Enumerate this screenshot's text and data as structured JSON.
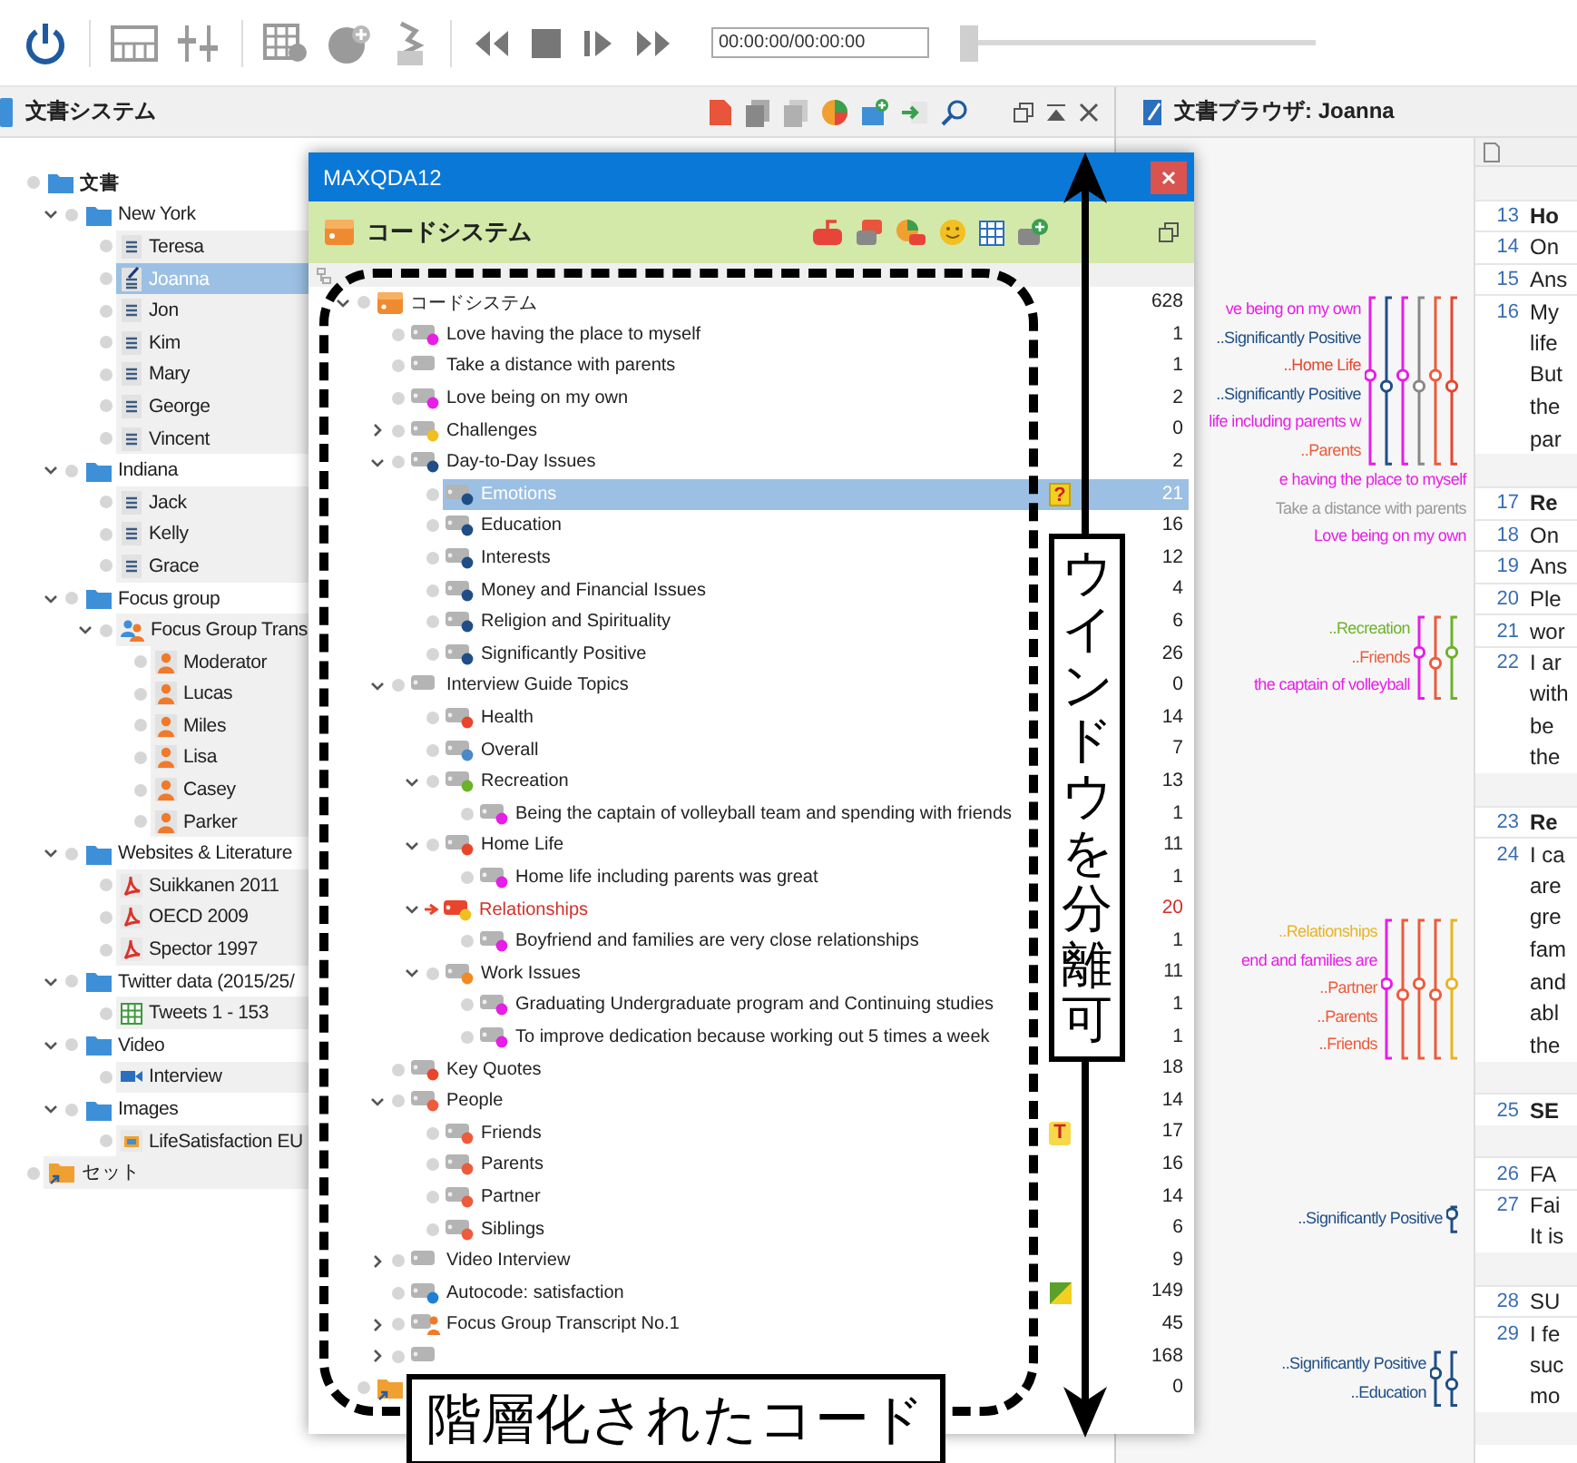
{
  "toolbar": {
    "time_field": "00:00:00/00:00:00",
    "position_slider": {
      "level": 0
    }
  },
  "document_system": {
    "title": "文書システム",
    "tree": [
      {
        "name": "文書",
        "kind": "root",
        "selected": false,
        "children": [
          {
            "name": "New York",
            "kind": "folder",
            "expanded": true,
            "selected": false,
            "children": [
              {
                "name": "Teresa",
                "kind": "text",
                "selected": false
              },
              {
                "name": "Joanna",
                "kind": "text-open",
                "selected": true
              },
              {
                "name": "Jon",
                "kind": "text",
                "selected": false
              },
              {
                "name": "Kim",
                "kind": "text",
                "selected": false
              },
              {
                "name": "Mary",
                "kind": "text",
                "selected": false
              },
              {
                "name": "George",
                "kind": "text",
                "selected": false
              },
              {
                "name": "Vincent",
                "kind": "text",
                "selected": false
              }
            ]
          },
          {
            "name": "Indiana",
            "kind": "folder",
            "expanded": true,
            "selected": false,
            "children": [
              {
                "name": "Jack",
                "kind": "text",
                "selected": false
              },
              {
                "name": "Kelly",
                "kind": "text",
                "selected": false
              },
              {
                "name": "Grace",
                "kind": "text",
                "selected": false
              }
            ]
          },
          {
            "name": "Focus group",
            "kind": "folder",
            "expanded": true,
            "selected": false,
            "children": [
              {
                "name": "Focus Group Trans",
                "kind": "focus-group",
                "expanded": true,
                "selected": false,
                "children": [
                  {
                    "name": "Moderator",
                    "kind": "person",
                    "selected": false
                  },
                  {
                    "name": "Lucas",
                    "kind": "person",
                    "selected": false
                  },
                  {
                    "name": "Miles",
                    "kind": "person",
                    "selected": false
                  },
                  {
                    "name": "Lisa",
                    "kind": "person",
                    "selected": false
                  },
                  {
                    "name": "Casey",
                    "kind": "person",
                    "selected": false
                  },
                  {
                    "name": "Parker",
                    "kind": "person",
                    "selected": false
                  }
                ]
              }
            ]
          },
          {
            "name": "Websites & Literature",
            "kind": "folder",
            "expanded": true,
            "selected": false,
            "children": [
              {
                "name": "Suikkanen 2011",
                "kind": "pdf",
                "selected": false
              },
              {
                "name": "OECD 2009",
                "kind": "pdf",
                "selected": false
              },
              {
                "name": "Spector 1997",
                "kind": "pdf",
                "selected": false
              }
            ]
          },
          {
            "name": "Twitter data (2015/25/",
            "kind": "folder",
            "expanded": true,
            "selected": false,
            "children": [
              {
                "name": "Tweets 1 - 153",
                "kind": "table",
                "selected": false
              }
            ]
          },
          {
            "name": "Video",
            "kind": "folder",
            "expanded": true,
            "selected": false,
            "children": [
              {
                "name": "Interview",
                "kind": "video",
                "selected": false
              }
            ]
          },
          {
            "name": "Images",
            "kind": "folder",
            "expanded": true,
            "selected": false,
            "children": [
              {
                "name": "LifeSatisfaction EU",
                "kind": "image",
                "selected": false
              }
            ]
          }
        ]
      },
      {
        "name": "セット",
        "kind": "set",
        "selected": false
      }
    ]
  },
  "document_browser": {
    "title": "文書ブラウザ: Joanna",
    "code_groups": [
      {
        "labels": [
          {
            "text": "ve being on my own",
            "color": "#e61ee6"
          },
          {
            "text": "..Significantly Positive",
            "color": "#1f4e86"
          },
          {
            "text": "..Home Life",
            "color": "#e8452c"
          },
          {
            "text": "..Significantly Positive",
            "color": "#1f4e86"
          },
          {
            "text": "life including parents w",
            "color": "#e61ee6"
          },
          {
            "text": "..Parents",
            "color": "#ec5b3c"
          }
        ],
        "stripes": [
          {
            "color": "#e61ee6"
          },
          {
            "color": "#1f4e86"
          },
          {
            "color": "#e61ee6"
          },
          {
            "color": "#888888"
          },
          {
            "color": "#ec5b3c"
          },
          {
            "color": "#e8452c"
          }
        ]
      },
      {
        "labels": [
          {
            "text": "e having the place to myself",
            "color": "#e61ee6"
          },
          {
            "text": "Take a distance with parents",
            "color": "#999999"
          },
          {
            "text": "Love being on my own",
            "color": "#e61ee6"
          }
        ]
      },
      {
        "labels": [
          {
            "text": "..Recreation",
            "color": "#6cb22a"
          },
          {
            "text": "..Friends",
            "color": "#ec5b3c"
          },
          {
            "text": "the captain of volleyball",
            "color": "#e61ee6"
          }
        ],
        "stripes": [
          {
            "color": "#e61ee6"
          },
          {
            "color": "#ec5b3c"
          },
          {
            "color": "#6cb22a"
          }
        ]
      },
      {
        "labels": [
          {
            "text": "..Relationships",
            "color": "#e8b420"
          },
          {
            "text": "end and families are",
            "color": "#e61ee6"
          },
          {
            "text": "..Partner",
            "color": "#ec5b3c"
          },
          {
            "text": "..Parents",
            "color": "#ec5b3c"
          },
          {
            "text": "..Friends",
            "color": "#ec5b3c"
          }
        ],
        "stripes": [
          {
            "color": "#e61ee6"
          },
          {
            "color": "#ec5b3c"
          },
          {
            "color": "#ec5b3c"
          },
          {
            "color": "#ec5b3c"
          },
          {
            "color": "#e8b420"
          }
        ]
      },
      {
        "labels": [
          {
            "text": "..Significantly Positive",
            "color": "#1f4e86"
          }
        ],
        "stripes": [
          {
            "color": "#1f4e86"
          }
        ]
      },
      {
        "labels": [
          {
            "text": "..Significantly Positive",
            "color": "#1f4e86"
          },
          {
            "text": "..Education",
            "color": "#1f4e86"
          }
        ],
        "stripes": [
          {
            "color": "#1f4e86"
          },
          {
            "color": "#1f4e86"
          }
        ]
      }
    ],
    "blocks": [
      {
        "paragraphs": [
          {
            "number": "13",
            "heading": true,
            "lines": [
              "Ho"
            ]
          },
          {
            "number": "14",
            "heading": false,
            "lines": [
              "On"
            ]
          },
          {
            "number": "15",
            "heading": false,
            "lines": [
              "Ans"
            ]
          },
          {
            "number": "16",
            "heading": false,
            "lines": [
              "My",
              "life",
              "But",
              "the",
              "par"
            ]
          }
        ]
      },
      {
        "paragraphs": [
          {
            "number": "17",
            "heading": true,
            "lines": [
              "Re"
            ]
          },
          {
            "number": "18",
            "heading": false,
            "lines": [
              "On"
            ]
          },
          {
            "number": "19",
            "heading": false,
            "lines": [
              "Ans"
            ]
          },
          {
            "number": "20",
            "heading": false,
            "lines": [
              "Ple"
            ]
          },
          {
            "number": "21",
            "heading": false,
            "lines": [
              "wor"
            ]
          },
          {
            "number": "22",
            "heading": false,
            "lines": [
              "I ar",
              "with",
              "be",
              "the"
            ]
          }
        ]
      },
      {
        "paragraphs": [
          {
            "number": "23",
            "heading": true,
            "lines": [
              "Re"
            ]
          },
          {
            "number": "24",
            "heading": false,
            "lines": [
              "I ca",
              "are",
              "gre",
              "fam",
              "and",
              "abl",
              "the"
            ]
          }
        ]
      },
      {
        "paragraphs": [
          {
            "number": "25",
            "heading": true,
            "lines": [
              "SE"
            ]
          }
        ]
      },
      {
        "paragraphs": [
          {
            "number": "26",
            "heading": false,
            "lines": [
              "FA"
            ]
          },
          {
            "number": "27",
            "heading": false,
            "lines": [
              "Fai",
              "It is"
            ]
          }
        ]
      },
      {
        "paragraphs": [
          {
            "number": "28",
            "heading": false,
            "lines": [
              "SU"
            ]
          },
          {
            "number": "29",
            "heading": false,
            "lines": [
              "I fe",
              "suc",
              "mo"
            ]
          }
        ]
      }
    ]
  },
  "code_window": {
    "title": "MAXQDA12",
    "header": "コードシステム",
    "codes": [
      {
        "name": "コードシステム",
        "count": "628",
        "kind": "root",
        "expanded": true,
        "selected": false,
        "activated": false,
        "children": [
          {
            "name": "Love having the place to myself",
            "count": "1",
            "kind": "code",
            "color": "#e61ee6",
            "selected": false,
            "activated": false
          },
          {
            "name": "Take a distance with parents",
            "count": "1",
            "kind": "code",
            "selected": false,
            "activated": false
          },
          {
            "name": "Love being on my own",
            "count": "2",
            "kind": "code",
            "color": "#e61ee6",
            "selected": false,
            "activated": false
          },
          {
            "name": "Challenges",
            "count": "0",
            "kind": "code",
            "color": "#f0c020",
            "expanded": false,
            "selected": false,
            "activated": false
          },
          {
            "name": "Day-to-Day Issues",
            "count": "2",
            "kind": "code",
            "color": "#1f4e86",
            "expanded": true,
            "selected": false,
            "activated": false,
            "children": [
              {
                "name": "Emotions",
                "count": "21",
                "kind": "code",
                "color": "#1f4e86",
                "selected": true,
                "activated": false,
                "memo": {
                  "kind": "question",
                  "symbol": "?"
                }
              },
              {
                "name": "Education",
                "count": "16",
                "kind": "code",
                "color": "#1f4e86",
                "selected": false,
                "activated": false
              },
              {
                "name": "Interests",
                "count": "12",
                "kind": "code",
                "color": "#1f4e86",
                "selected": false,
                "activated": false
              },
              {
                "name": "Money and Financial Issues",
                "count": "4",
                "kind": "code",
                "color": "#1f4e86",
                "selected": false,
                "activated": false
              },
              {
                "name": "Religion and Spirituality",
                "count": "6",
                "kind": "code",
                "color": "#1f4e86",
                "selected": false,
                "activated": false
              },
              {
                "name": "Significantly Positive",
                "count": "26",
                "kind": "code",
                "color": "#1f4e86",
                "selected": false,
                "activated": false
              }
            ]
          },
          {
            "name": "Interview Guide Topics",
            "count": "0",
            "kind": "code",
            "expanded": true,
            "selected": false,
            "activated": false,
            "children": [
              {
                "name": "Health",
                "count": "14",
                "kind": "code",
                "color": "#e8452c",
                "selected": false,
                "activated": false
              },
              {
                "name": "Overall",
                "count": "7",
                "kind": "code",
                "color": "#4a88c8",
                "selected": false,
                "activated": false
              },
              {
                "name": "Recreation",
                "count": "13",
                "kind": "code",
                "color": "#6cb22a",
                "expanded": true,
                "selected": false,
                "activated": false,
                "children": [
                  {
                    "name": "Being the captain of volleyball team and spending with friends",
                    "count": "1",
                    "kind": "code",
                    "color": "#e61ee6",
                    "selected": false,
                    "activated": false
                  }
                ]
              },
              {
                "name": "Home Life",
                "count": "11",
                "kind": "code",
                "color": "#e8452c",
                "expanded": true,
                "selected": false,
                "activated": false,
                "children": [
                  {
                    "name": "Home life including parents was great",
                    "count": "1",
                    "kind": "code",
                    "color": "#e61ee6",
                    "selected": false,
                    "activated": false
                  }
                ]
              },
              {
                "name": "Relationships",
                "count": "20",
                "kind": "code",
                "color": "#f0c020",
                "expanded": true,
                "selected": false,
                "activated": true,
                "children": [
                  {
                    "name": "Boyfriend and families are very close relationships",
                    "count": "1",
                    "kind": "code",
                    "color": "#e61ee6",
                    "selected": false,
                    "activated": false
                  }
                ]
              },
              {
                "name": "Work Issues",
                "count": "11",
                "kind": "code",
                "color": "#f08a24",
                "expanded": true,
                "selected": false,
                "activated": false,
                "children": [
                  {
                    "name": "Graduating Undergraduate program and Continuing studies",
                    "count": "1",
                    "kind": "code",
                    "color": "#e61ee6",
                    "selected": false,
                    "activated": false
                  },
                  {
                    "name": "To improve dedication because working out 5 times a week",
                    "count": "1",
                    "kind": "code",
                    "color": "#e61ee6",
                    "selected": false,
                    "activated": false
                  }
                ]
              }
            ]
          },
          {
            "name": "Key Quotes",
            "count": "18",
            "kind": "code",
            "color": "#e8452c",
            "selected": false,
            "activated": false
          },
          {
            "name": "People",
            "count": "14",
            "kind": "code",
            "color": "#ec5b3c",
            "expanded": true,
            "selected": false,
            "activated": false,
            "children": [
              {
                "name": "Friends",
                "count": "17",
                "kind": "code",
                "color": "#ec5b3c",
                "selected": false,
                "activated": false,
                "memo": {
                  "kind": "text",
                  "symbol": "T"
                }
              },
              {
                "name": "Parents",
                "count": "16",
                "kind": "code",
                "color": "#ec5b3c",
                "selected": false,
                "activated": false
              },
              {
                "name": "Partner",
                "count": "14",
                "kind": "code",
                "color": "#ec5b3c",
                "selected": false,
                "activated": false
              },
              {
                "name": "Siblings",
                "count": "6",
                "kind": "code",
                "color": "#ec5b3c",
                "selected": false,
                "activated": false
              }
            ]
          },
          {
            "name": "Video Interview",
            "count": "9",
            "kind": "code",
            "expanded": false,
            "selected": false,
            "activated": false
          },
          {
            "name": "Autocode: satisfaction",
            "count": "149",
            "kind": "code",
            "color": "#1d7fd6",
            "selected": false,
            "activated": false,
            "memo": {
              "kind": "autocode"
            }
          },
          {
            "name": "Focus Group Transcript No.1",
            "count": "45",
            "kind": "person",
            "expanded": false,
            "selected": false,
            "activated": false
          },
          {
            "count": "168",
            "kind": "code",
            "expanded": false,
            "selected": false,
            "activated": false
          }
        ]
      },
      {
        "count": "0",
        "kind": "set",
        "selected": false,
        "activated": false
      }
    ]
  },
  "annotations": {
    "hierarchy_label": "階層化されたコード",
    "detach_label": "ウインドウを分離可"
  }
}
